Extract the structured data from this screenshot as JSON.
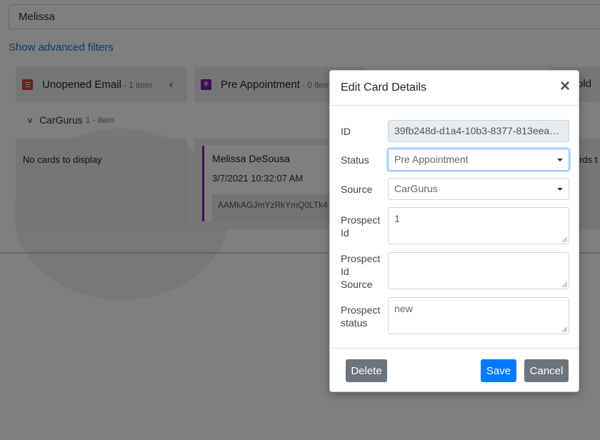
{
  "search": {
    "value": "Melissa"
  },
  "advanced_filters_link": "Show advanced filters",
  "columns": [
    {
      "title": "Unopened Email",
      "count": "- 1 item",
      "icon": "email-list-icon",
      "color": "#e53935"
    },
    {
      "title": "Pre Appointment",
      "count": "- 0 item",
      "icon": "appointment-icon",
      "color": "#7b1fa2"
    },
    {
      "title": "old",
      "count": ""
    }
  ],
  "group": {
    "name": "CarGurus",
    "count": "1 - item"
  },
  "lanes": {
    "empty_text": "No cards to display",
    "right_partial_text": "ards t"
  },
  "card": {
    "name": "Melissa DeSousa",
    "date": "3/7/2021 10:32:07 AM",
    "id_text": "AAMkAGJmYzRkYmQ0LTk4"
  },
  "modal": {
    "title": "Edit Card Details",
    "close_glyph": "×",
    "fields": {
      "id": {
        "label": "ID",
        "value": "39fb248d-d1a4-10b3-8377-813eea9..."
      },
      "status": {
        "label": "Status",
        "value": "Pre Appointment"
      },
      "source": {
        "label": "Source",
        "value": "CarGurus"
      },
      "prospect_id": {
        "label_lines": [
          "Prospect",
          "Id"
        ],
        "value": "1"
      },
      "prospect_id_source": {
        "label_lines": [
          "Prospect",
          "Id",
          "Source"
        ],
        "value": ""
      },
      "prospect_status": {
        "label_lines": [
          "Prospect",
          "status"
        ],
        "value": "new"
      }
    },
    "buttons": {
      "delete": "Delete",
      "save": "Save",
      "cancel": "Cancel"
    }
  },
  "colors": {
    "primary": "#007bff",
    "secondary": "#6c757d",
    "link": "#1a73e8"
  }
}
